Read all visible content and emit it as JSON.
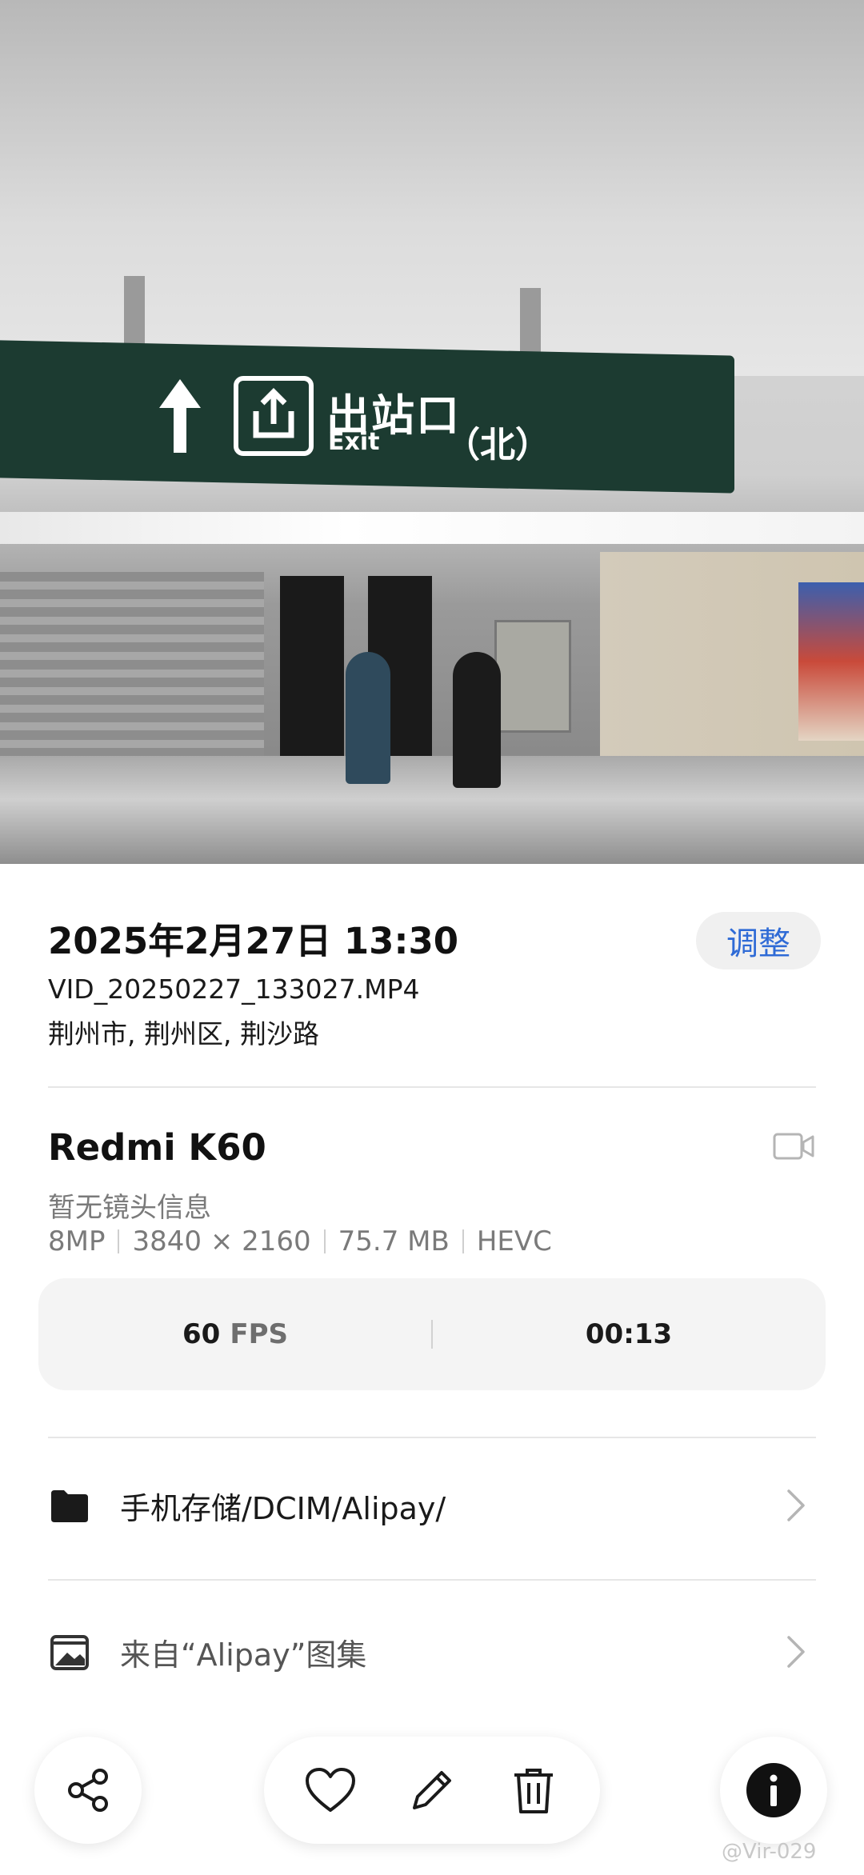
{
  "info": {
    "datetime": "2025年2月27日 13:30",
    "adjust_label": "调整",
    "filename": "VID_20250227_133027.MP4",
    "location": "荆州市, 荆州区, 荆沙路"
  },
  "camera": {
    "model": "Redmi K60",
    "lens_info": "暂无镜头信息",
    "specs": [
      "8MP",
      "3840 × 2160",
      "75.7 MB",
      "HEVC"
    ],
    "fps_value": "60",
    "fps_unit": "FPS",
    "duration": "00:13"
  },
  "storage": {
    "path": "手机存储/DCIM/Alipay/",
    "album": "来自“Alipay”图集"
  },
  "photo_sign": {
    "chinese": "出站口",
    "english": "Exit",
    "direction": "（北）"
  },
  "watermark": "@Vir-029",
  "icons": [
    "share-icon",
    "heart-icon",
    "edit-icon",
    "delete-icon",
    "info-icon",
    "folder-icon",
    "album-icon",
    "video-camera-icon",
    "chevron-right-icon"
  ],
  "colors": {
    "accent": "#2f6bd6",
    "sign_green": "#1c3b31"
  }
}
